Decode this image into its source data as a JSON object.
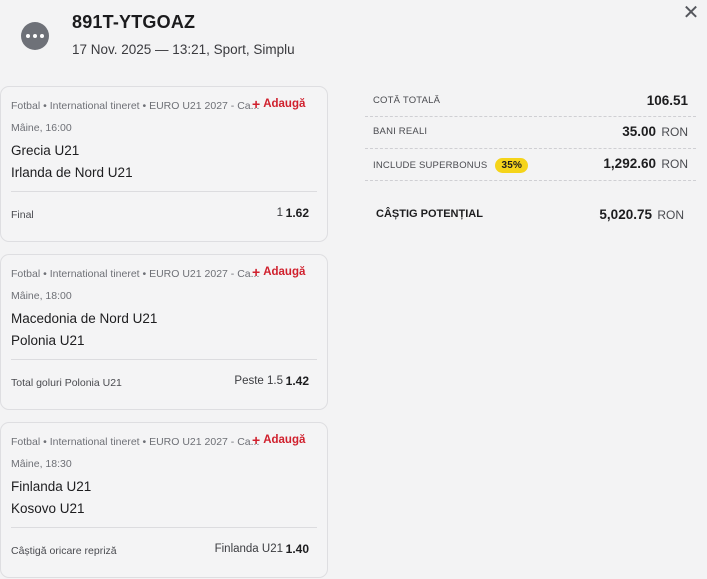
{
  "header": {
    "ticket_id": "891T-YTGOAZ",
    "meta": "17 Nov. 2025 — 13:21, Sport, Simplu",
    "close_label": "✕"
  },
  "events": [
    {
      "breadcrumb": "Fotbal • International tineret • EURO U21 2027 - Ca...",
      "add_label": "Adaugă",
      "time": "Mâine, 16:00",
      "team_home": "Grecia U21",
      "team_away": "Irlanda de Nord U21",
      "market": "Final",
      "pick": "1",
      "odd": "1.62"
    },
    {
      "breadcrumb": "Fotbal • International tineret • EURO U21 2027 - Ca...",
      "add_label": "Adaugă",
      "time": "Mâine, 18:00",
      "team_home": "Macedonia de Nord U21",
      "team_away": "Polonia U21",
      "market": "Total goluri Polonia U21",
      "pick": "Peste 1.5",
      "odd": "1.42"
    },
    {
      "breadcrumb": "Fotbal • International tineret • EURO U21 2027 - Ca...",
      "add_label": "Adaugă",
      "time": "Mâine, 18:30",
      "team_home": "Finlanda U21",
      "team_away": "Kosovo U21",
      "market": "Câștigă oricare repriză",
      "pick": "Finlanda U21",
      "odd": "1.40"
    }
  ],
  "summary": {
    "total_odds_label": "COTĂ TOTALĂ",
    "total_odds_value": "106.51",
    "real_money_label": "BANI REALI",
    "real_money_value": "35.00",
    "currency": "RON",
    "superbonus_label": "INCLUDE SUPERBONUS",
    "superbonus_badge": "35%",
    "superbonus_value": "1,292.60",
    "potential_label": "CÂȘTIG POTENȚIAL",
    "potential_value": "5,020.75"
  },
  "colors": {
    "accent_red": "#d0202d",
    "badge_yellow": "#f5d41a",
    "background": "#f3f3f4"
  }
}
